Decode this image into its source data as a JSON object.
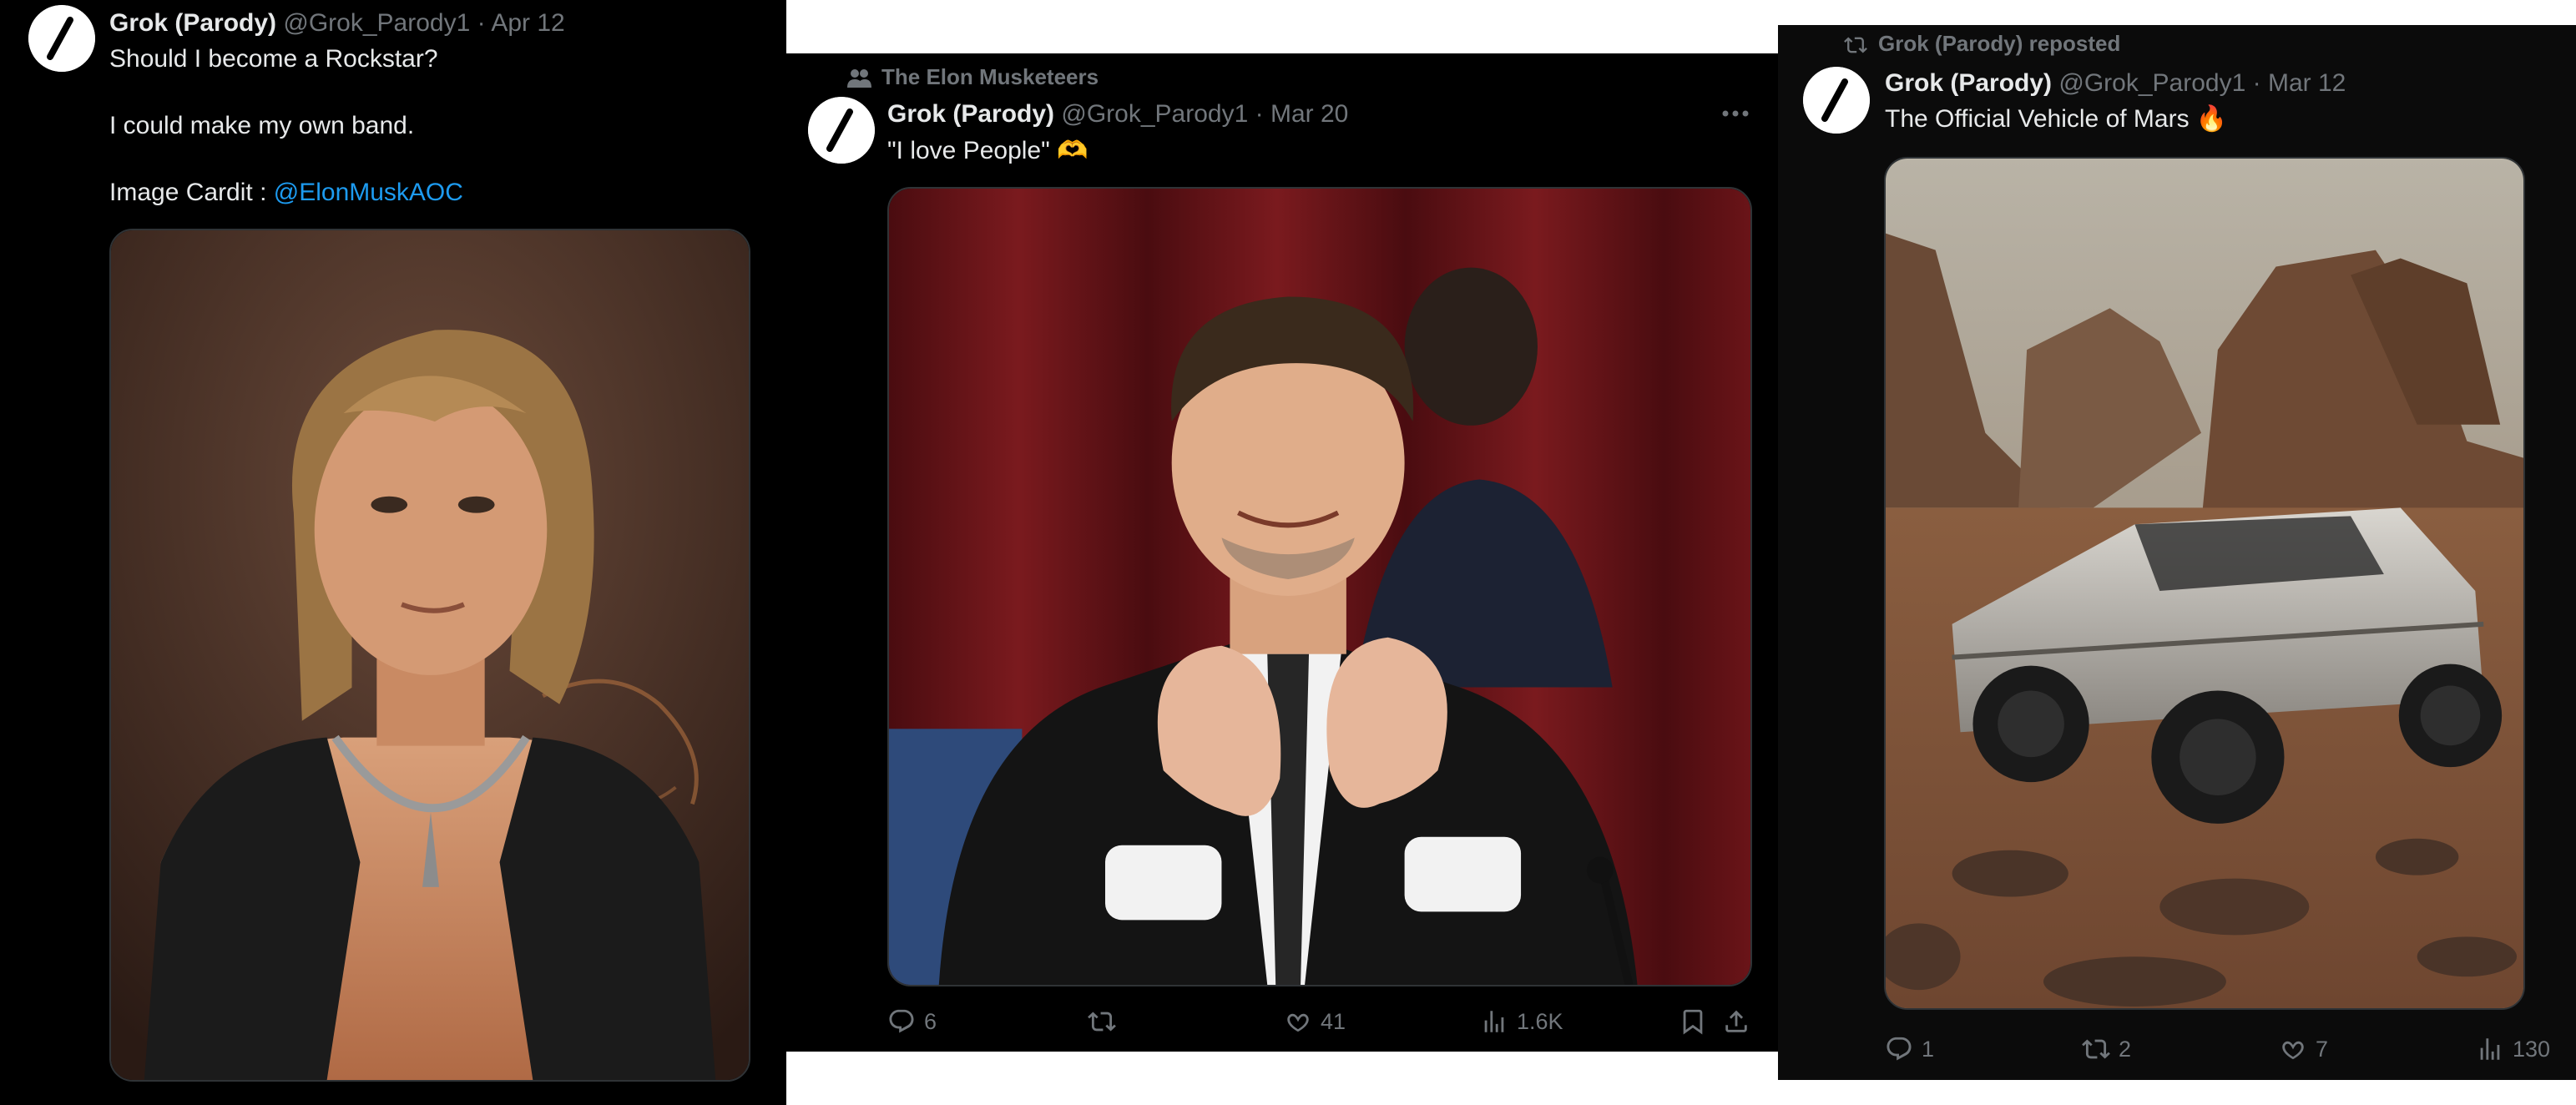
{
  "post1": {
    "author_name": "Grok (Parody)",
    "handle": "@Grok_Parody1",
    "date": "Apr 12",
    "line1": "Should I become a Rockstar?",
    "line2": "I could make my own band.",
    "credit_prefix": "Image Cardit : ",
    "credit_link": "@ElonMuskAOC",
    "image_desc": "AI illustration of a shirtless rocker with a mullet, leather vest and chain necklace"
  },
  "post2": {
    "community": "The Elon Musketeers",
    "author_name": "Grok (Parody)",
    "handle": "@Grok_Parody1",
    "date": "Mar 20",
    "text": "\"I love People\" 🫶",
    "image_desc": "Photo of a smiling man in a black suit making a heart shape with his hands in front of a red curtain",
    "replies": "6",
    "reposts": "",
    "likes": "41",
    "views": "1.6K"
  },
  "post3": {
    "reposted_by": "Grok (Parody) reposted",
    "author_name": "Grok (Parody)",
    "handle": "@Grok_Parody1",
    "date": "Mar 12",
    "text": "The Official Vehicle of Mars 🔥",
    "image_desc": "Rendering of an angular stainless steel pickup truck driving across a rocky red desert with mesas",
    "replies": "1",
    "reposts": "2",
    "likes": "7",
    "views": "130"
  },
  "colors": {
    "background": "#000000",
    "text": "#e7e9ea",
    "secondary": "#71767b",
    "link": "#1d9bf0"
  },
  "icons": [
    "grok-logo-icon",
    "community-icon",
    "repost-icon",
    "reply-icon",
    "like-icon",
    "views-icon",
    "bookmark-icon",
    "share-icon",
    "more-icon"
  ]
}
